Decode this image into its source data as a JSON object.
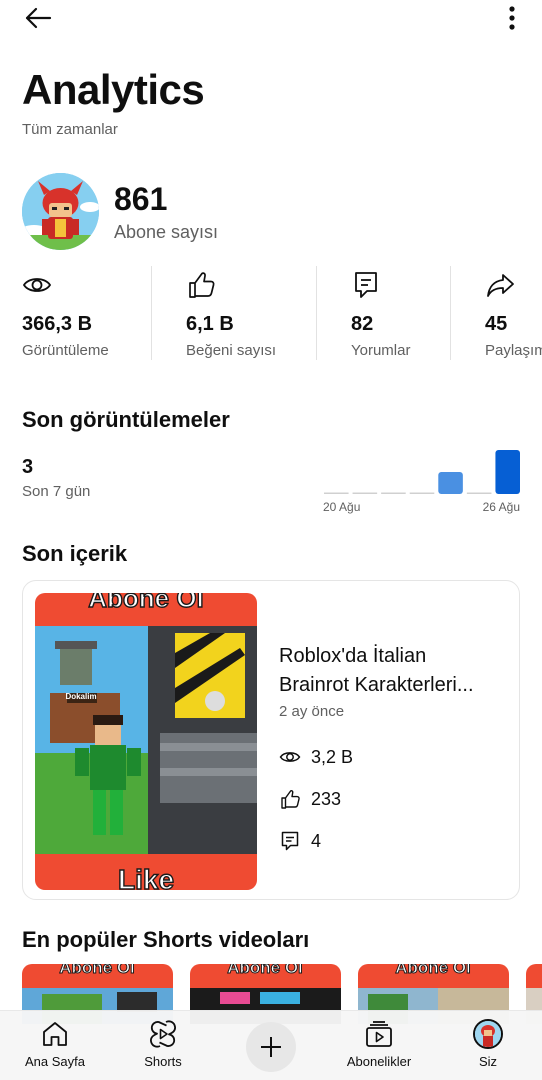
{
  "page": {
    "title": "Analytics",
    "subtitle": "Tüm zamanlar"
  },
  "channel": {
    "subscribers": "861",
    "subscribers_label": "Abone sayısı"
  },
  "stats": [
    {
      "icon": "eye-icon",
      "value": "366,3 B",
      "label": "Görüntüleme"
    },
    {
      "icon": "thumbs-up-icon",
      "value": "6,1 B",
      "label": "Beğeni sayısı"
    },
    {
      "icon": "comment-icon",
      "value": "82",
      "label": "Yorumlar"
    },
    {
      "icon": "share-icon",
      "value": "45",
      "label": "Paylaşım"
    }
  ],
  "recent_views": {
    "title": "Son görüntülemeler",
    "value": "3",
    "period": "Son 7 gün",
    "chart_data": {
      "type": "bar",
      "x_start_label": "20 Ağu",
      "x_end_label": "26 Ağu",
      "values": [
        0,
        0,
        0,
        0,
        1,
        0,
        2
      ],
      "colors": [
        "#4a90e2",
        "#065fd4"
      ]
    }
  },
  "latest_content": {
    "title": "Son içerik",
    "thumbnail_text": {
      "top": "Abone Ol",
      "bottom": "Like",
      "sign": "Dokalim"
    },
    "video_title_line1": "Roblox'da İtalian",
    "video_title_line2": "Brainrot Karakterleri...",
    "age": "2 ay önce",
    "views": "3,2 B",
    "likes": "233",
    "comments": "4"
  },
  "shorts": {
    "title": "En popüler Shorts videoları",
    "thumb_label": "Abone Ol"
  },
  "nav": {
    "home": "Ana Sayfa",
    "shorts": "Shorts",
    "subscriptions": "Abonelikler",
    "you": "Siz"
  },
  "colors": {
    "accent_blue": "#065fd4",
    "light_blue": "#4a90e2",
    "thumb_red": "#ef4b32",
    "text_secondary": "#606060"
  }
}
